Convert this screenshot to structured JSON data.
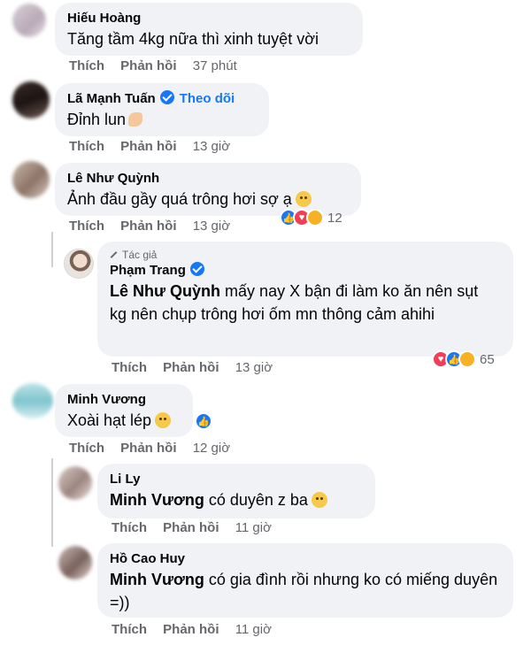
{
  "actions": {
    "like": "Thích",
    "reply": "Phản hồi"
  },
  "comments": [
    {
      "name": "Hiếu Hoàng",
      "text": "Tăng tầm 4kg nữa thì xinh tuyệt vời",
      "time": "37 phút"
    },
    {
      "name": "Lã Mạnh Tuấn",
      "follow": "Theo dõi",
      "text": "Đỉnh lun",
      "time": "13 giờ"
    },
    {
      "name": "Lê Như Quỳnh",
      "text": "Ảnh đầu gầy quá trông hơi sợ ạ",
      "time": "13 giờ",
      "reactions": "12"
    },
    {
      "author_badge": "Tác giả",
      "name": "Phạm Trang",
      "mention": "Lê Như Quỳnh",
      "text": " mấy nay X bận đi làm ko ăn nên sụt kg nên chụp trông hơi ốm mn thông cảm ahihi",
      "time": "13 giờ",
      "reactions": "65"
    },
    {
      "name": "Minh Vương",
      "text": "Xoài hạt lép",
      "time": "12 giờ"
    },
    {
      "name": "Li Ly",
      "mention": "Minh Vương",
      "text": " có duyên z ba",
      "time": "11 giờ"
    },
    {
      "name": "Hồ Cao Huy",
      "mention": "Minh Vương",
      "text": " có gia đình rồi nhưng ko có miếng duyên =))",
      "time": "11 giờ"
    }
  ],
  "colors": {
    "bubble": "#f0f2f5",
    "accent": "#1877f2",
    "muted": "#65676b"
  },
  "icons": [
    "verified-badge-icon",
    "like-reaction-icon",
    "love-reaction-icon",
    "haha-reaction-icon",
    "care-reaction-icon",
    "author-badge-icon"
  ]
}
